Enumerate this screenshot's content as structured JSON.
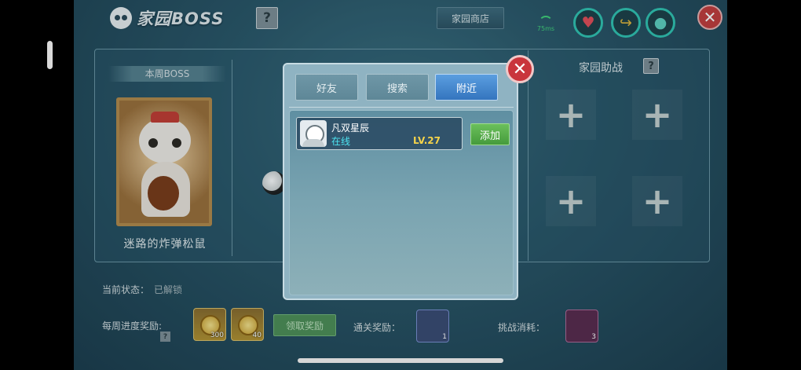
{
  "header": {
    "title": "家园BOSS",
    "help_label": "?",
    "shop_label": "家园商店",
    "signal_text": "75ms",
    "close_label": "✕",
    "icons": [
      "heart-icon",
      "arrow-icon",
      "drop-icon"
    ]
  },
  "boss": {
    "tag": "本周BOSS",
    "name": "迷路的炸弹松鼠"
  },
  "assist": {
    "title": "家园助战",
    "help_label": "?",
    "slots": [
      "+",
      "+",
      "+",
      "+"
    ]
  },
  "status": {
    "label": "当前状态：",
    "value": "已解锁"
  },
  "weekly": {
    "label": "每周进度奖励:",
    "help_label": "?",
    "rewards": [
      {
        "count": "300"
      },
      {
        "count": "40"
      }
    ],
    "claim_label": "领取奖励"
  },
  "clear_reward": {
    "label": "通关奖励：",
    "count": "1"
  },
  "challenge_cost": {
    "label": "挑战消耗：",
    "count": "3"
  },
  "modal": {
    "tabs": [
      "好友",
      "搜索",
      "附近"
    ],
    "active_tab": "附近",
    "close_label": "✕",
    "friend": {
      "name": "凡双星辰",
      "status": "在线",
      "level": "LV.27",
      "add_label": "添加"
    }
  },
  "colors": {
    "active_tab": "#3475be",
    "online": "#4de4f1",
    "level": "#f5d34a",
    "add_button": "#459b3c",
    "close": "#c9353c"
  }
}
